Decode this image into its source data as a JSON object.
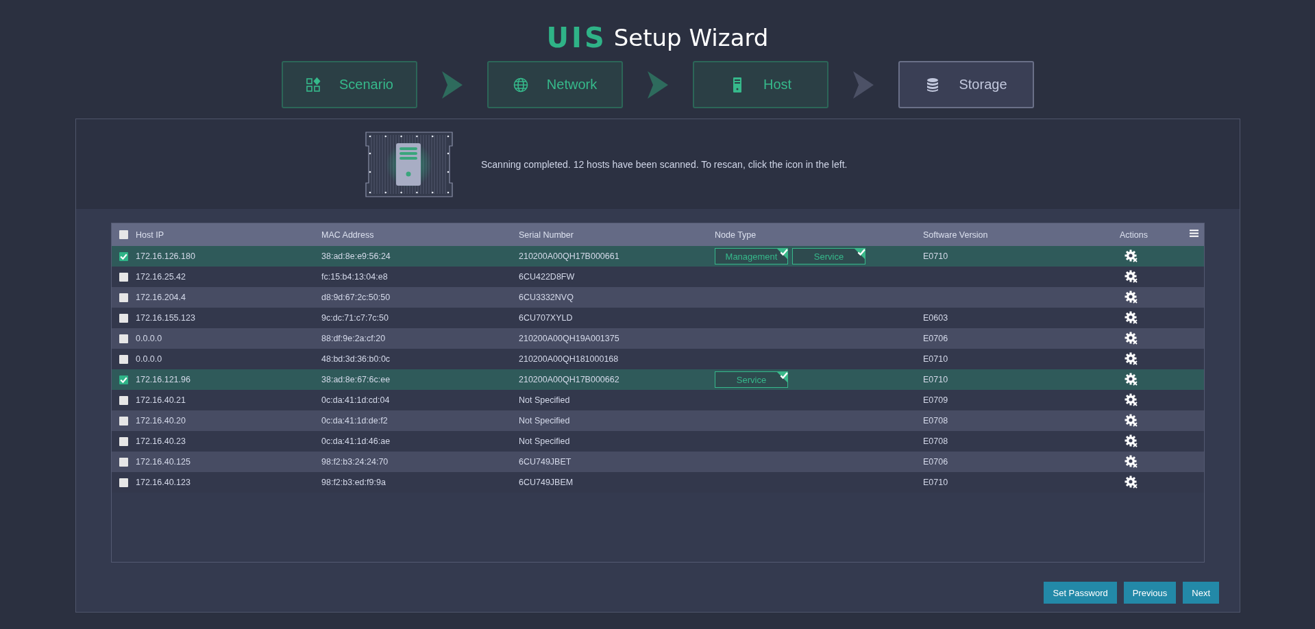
{
  "header": {
    "logo": "UIS",
    "title": "Setup Wizard"
  },
  "steps": [
    {
      "label": "Scenario",
      "kind": "apps",
      "active": true
    },
    {
      "label": "Network",
      "kind": "globe",
      "active": true
    },
    {
      "label": "Host",
      "kind": "server",
      "active": true
    },
    {
      "label": "Storage",
      "kind": "database",
      "active": false
    }
  ],
  "scan": {
    "message": "Scanning completed. 12 hosts have been scanned. To rescan, click the icon in the left."
  },
  "table": {
    "select_all_checked": false,
    "columns": [
      "Host IP",
      "MAC Address",
      "Serial Number",
      "Node Type",
      "Software Version",
      "Actions"
    ],
    "rows": [
      {
        "checked": true,
        "host_ip": "172.16.126.180",
        "mac": "38:ad:8e:e9:56:24",
        "serial": "210200A00QH17B000661",
        "node_types": [
          "Management",
          "Service"
        ],
        "version": "E0710"
      },
      {
        "checked": false,
        "host_ip": "172.16.25.42",
        "mac": "fc:15:b4:13:04:e8",
        "serial": "6CU422D8FW",
        "node_types": [],
        "version": ""
      },
      {
        "checked": false,
        "host_ip": "172.16.204.4",
        "mac": "d8:9d:67:2c:50:50",
        "serial": "6CU3332NVQ",
        "node_types": [],
        "version": ""
      },
      {
        "checked": false,
        "host_ip": "172.16.155.123",
        "mac": "9c:dc:71:c7:7c:50",
        "serial": "6CU707XYLD",
        "node_types": [],
        "version": "E0603"
      },
      {
        "checked": false,
        "host_ip": "0.0.0.0",
        "mac": "88:df:9e:2a:cf:20",
        "serial": "210200A00QH19A001375",
        "node_types": [],
        "version": "E0706"
      },
      {
        "checked": false,
        "host_ip": "0.0.0.0",
        "mac": "48:bd:3d:36:b0:0c",
        "serial": "210200A00QH181000168",
        "node_types": [],
        "version": "E0710"
      },
      {
        "checked": true,
        "host_ip": "172.16.121.96",
        "mac": "38:ad:8e:67:6c:ee",
        "serial": "210200A00QH17B000662",
        "node_types": [
          "Service"
        ],
        "version": "E0710"
      },
      {
        "checked": false,
        "host_ip": "172.16.40.21",
        "mac": "0c:da:41:1d:cd:04",
        "serial": "Not Specified",
        "node_types": [],
        "version": "E0709"
      },
      {
        "checked": false,
        "host_ip": "172.16.40.20",
        "mac": "0c:da:41:1d:de:f2",
        "serial": "Not Specified",
        "node_types": [],
        "version": "E0708"
      },
      {
        "checked": false,
        "host_ip": "172.16.40.23",
        "mac": "0c:da:41:1d:46:ae",
        "serial": "Not Specified",
        "node_types": [],
        "version": "E0708"
      },
      {
        "checked": false,
        "host_ip": "172.16.40.125",
        "mac": "98:f2:b3:24:24:70",
        "serial": "6CU749JBET",
        "node_types": [],
        "version": "E0706"
      },
      {
        "checked": false,
        "host_ip": "172.16.40.123",
        "mac": "98:f2:b3:ed:f9:9a",
        "serial": "6CU749JBEM",
        "node_types": [],
        "version": "E0710"
      }
    ]
  },
  "buttons": [
    "Set Password",
    "Previous",
    "Next"
  ]
}
